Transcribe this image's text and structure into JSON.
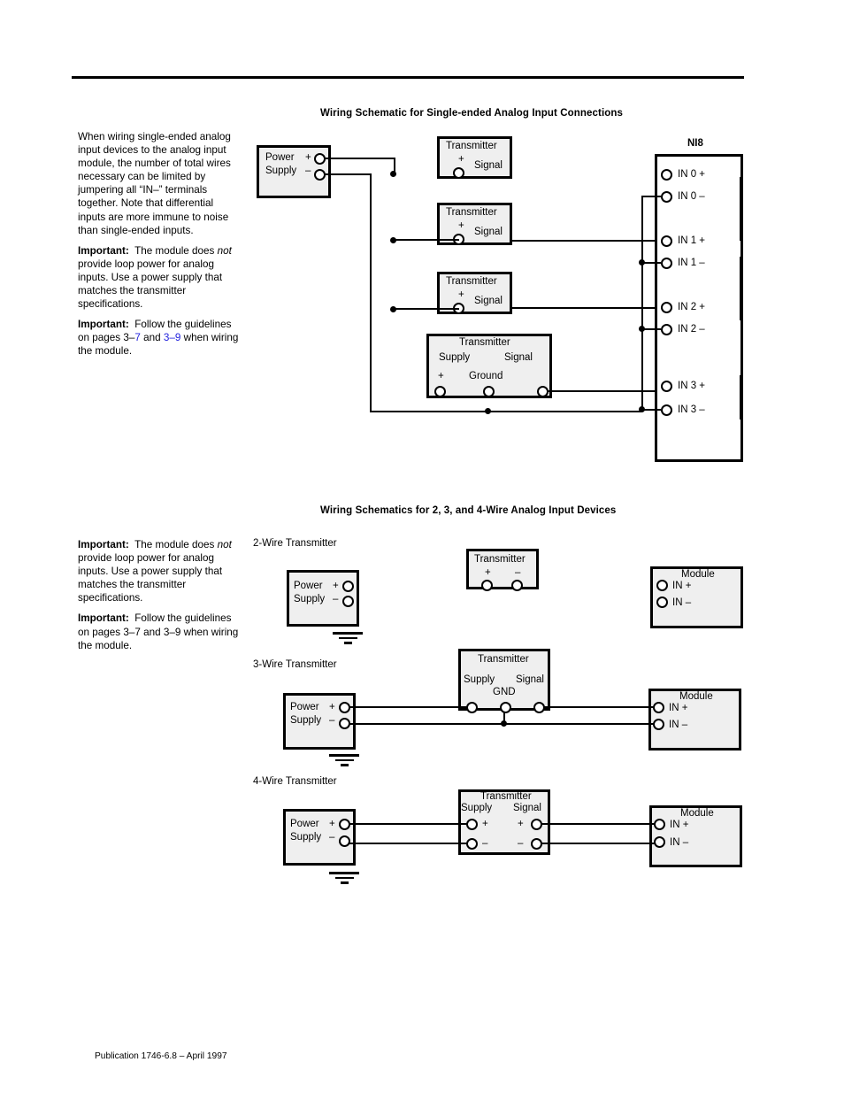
{
  "document": {
    "footer": "Publication 1746-6.8 – April 1997"
  },
  "section1": {
    "title": "Wiring Schematic for Single-ended Analog Input Connections",
    "intro": "When wiring single-ended analog input devices to the analog input module, the number of total wires necessary can be limited by jumpering all “IN–” terminals together.  Note that differential inputs are more immune to noise than single-ended inputs.",
    "important1_label": "Important:",
    "important1_part1": "The module does ",
    "important1_italic": "not",
    "important1_part2": " provide loop power for analog inputs.  Use a power supply that matches the transmitter specifications.",
    "important2_label": "Important:",
    "important2_part1": "Follow the guidelines on pages ",
    "important2_ref1_prefix": "3–",
    "important2_ref1_num": "7",
    "important2_mid": " and ",
    "important2_ref2": "3–9",
    "important2_part2": " when wiring the module.",
    "power_supply": {
      "line1": "Power",
      "line2": "Supply",
      "plus": "+",
      "minus": "–"
    },
    "transmitters": [
      {
        "title": "Transmitter",
        "plus": "+",
        "signal": "Signal"
      },
      {
        "title": "Transmitter",
        "plus": "+",
        "signal": "Signal"
      },
      {
        "title": "Transmitter",
        "plus": "+",
        "signal": "Signal"
      }
    ],
    "transmitter4": {
      "title": "Transmitter",
      "supply": "Supply",
      "signal": "Signal",
      "plus": "+",
      "ground": "Ground"
    },
    "module": {
      "name": "NI8",
      "terminals": [
        "IN 0 +",
        "IN 0 –",
        "IN 1 +",
        "IN 1 –",
        "IN 2 +",
        "IN 2 –",
        "IN 3 +",
        "IN 3 –"
      ]
    }
  },
  "section2": {
    "title": "Wiring Schematics for 2, 3, and 4-Wire Analog Input Devices",
    "important1_label": "Important:",
    "important1_part1": "The module does ",
    "important1_italic": "not",
    "important1_part2": " provide loop power for analog inputs.  Use a power supply that matches the transmitter specifications.",
    "important2_label": "Important:",
    "important2_part1": "Follow the guidelines on pages 3–7 and  3–9 when wiring the module.",
    "diagrams": [
      {
        "caption": "2-Wire Transmitter",
        "power_supply": {
          "line1": "Power",
          "line2": "Supply",
          "plus": "+",
          "minus": "–"
        },
        "transmitter": {
          "title": "Transmitter",
          "plus": "+",
          "minus": "–"
        },
        "module": {
          "name": "Module",
          "in_plus": "IN  +",
          "in_minus": "IN  –"
        }
      },
      {
        "caption": "3-Wire Transmitter",
        "power_supply": {
          "line1": "Power",
          "line2": "Supply",
          "plus": "+",
          "minus": "–"
        },
        "transmitter": {
          "title": "Transmitter",
          "supply": "Supply",
          "signal": "Signal",
          "gnd": "GND"
        },
        "module": {
          "name": "Module",
          "in_plus": "IN  +",
          "in_minus": "IN  –"
        }
      },
      {
        "caption": "4-Wire Transmitter",
        "power_supply": {
          "line1": "Power",
          "line2": "Supply",
          "plus": "+",
          "minus": "–"
        },
        "transmitter": {
          "title": "Transmitter",
          "supply": "Supply",
          "signal": "Signal",
          "sp": "+",
          "sm": "–",
          "gp": "+",
          "gm": "–"
        },
        "module": {
          "name": "Module",
          "in_plus": "IN  +",
          "in_minus": "IN  –"
        }
      }
    ]
  }
}
